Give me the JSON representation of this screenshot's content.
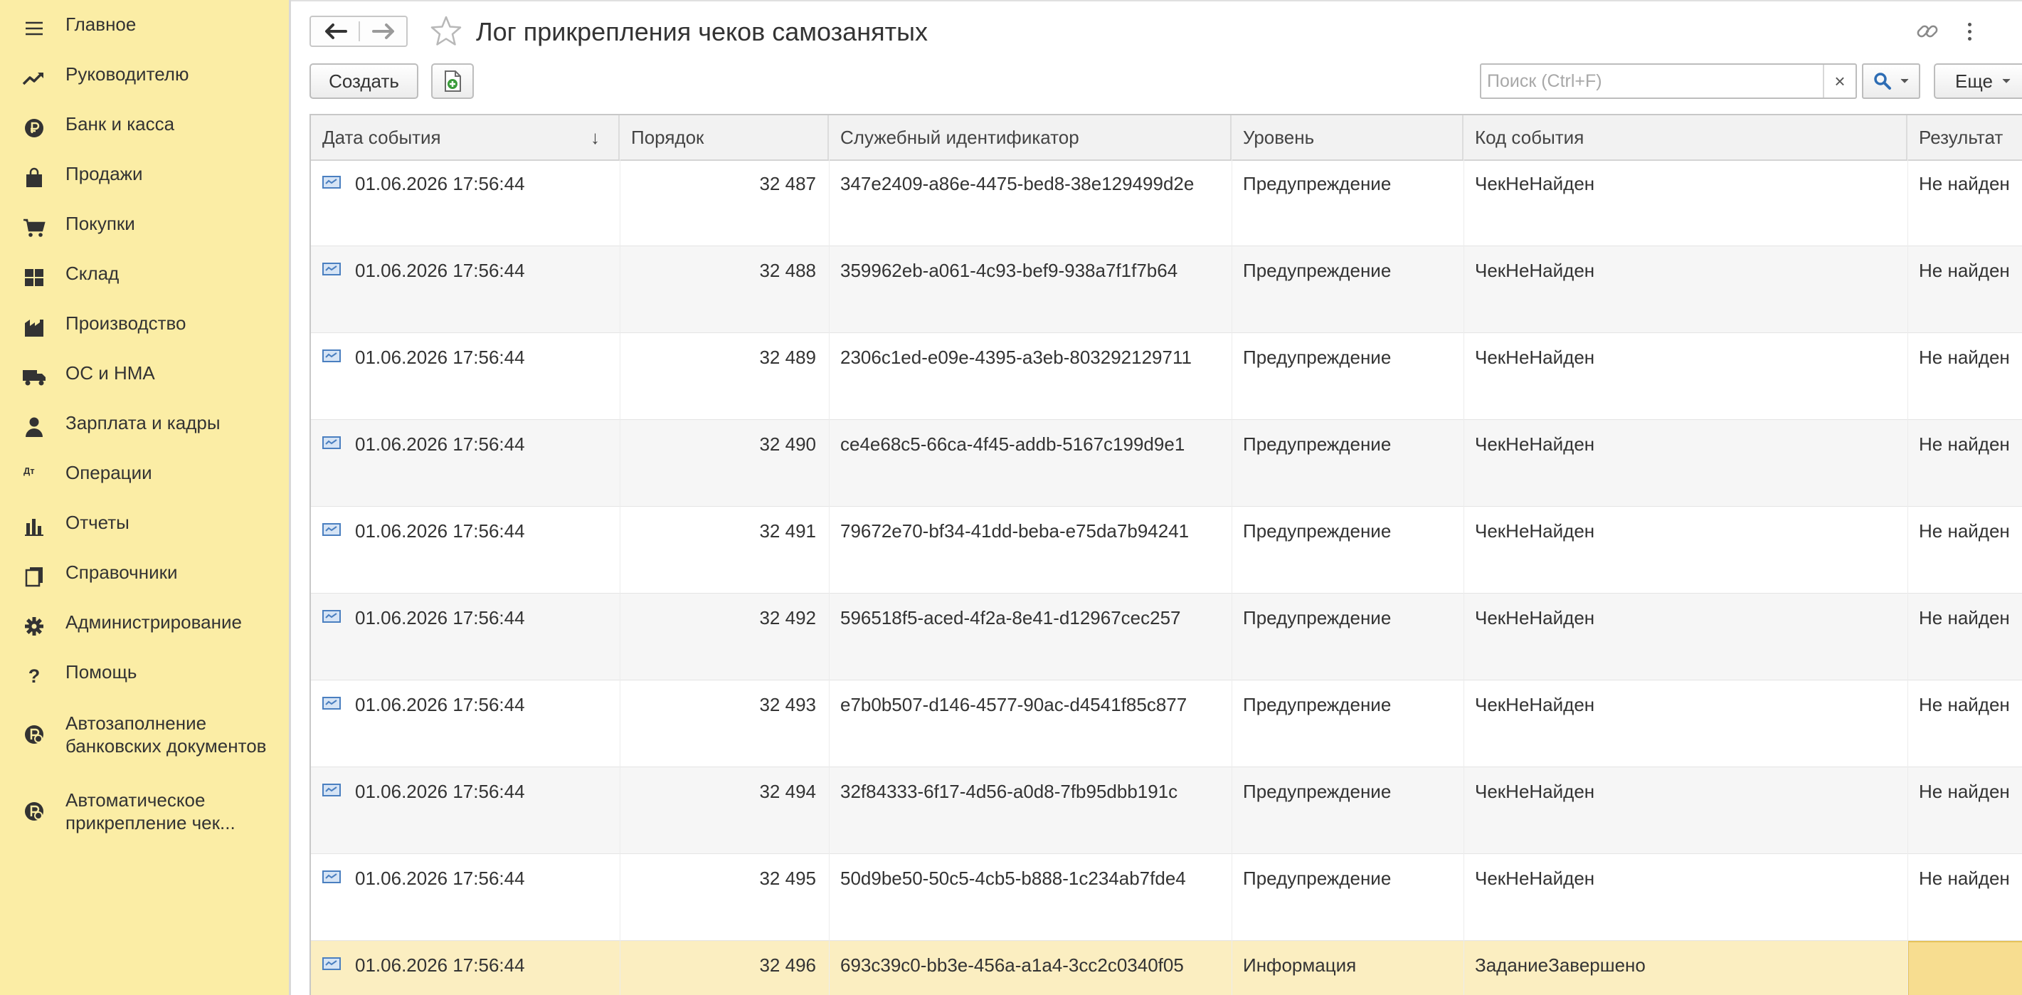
{
  "sidebar": {
    "items": [
      {
        "label": "Главное",
        "icon": "menu-icon"
      },
      {
        "label": "Руководителю",
        "icon": "trend-chart-icon"
      },
      {
        "label": "Банк и касса",
        "icon": "ruble-coin-icon"
      },
      {
        "label": "Продажи",
        "icon": "shopping-bag-icon"
      },
      {
        "label": "Покупки",
        "icon": "shopping-cart-icon"
      },
      {
        "label": "Склад",
        "icon": "warehouse-icon"
      },
      {
        "label": "Производство",
        "icon": "factory-icon"
      },
      {
        "label": "ОС и НМА",
        "icon": "truck-icon"
      },
      {
        "label": "Зарплата и кадры",
        "icon": "person-icon"
      },
      {
        "label": "Операции",
        "icon": "debit-credit-icon"
      },
      {
        "label": "Отчеты",
        "icon": "bar-chart-icon"
      },
      {
        "label": "Справочники",
        "icon": "books-icon"
      },
      {
        "label": "Администрирование",
        "icon": "gear-icon"
      },
      {
        "label": "Помощь",
        "icon": "question-icon"
      },
      {
        "label": "Автозаполнение\nбанковских документов",
        "icon": "extension-icon"
      },
      {
        "label": "Автоматическое\nприкрепление чек...",
        "icon": "extension-icon"
      }
    ],
    "debit_credit_glyph": "Дт Кт"
  },
  "header": {
    "title": "Лог прикрепления чеков самозанятых",
    "back_icon": "arrow-left-icon",
    "forward_icon": "arrow-right-icon",
    "favorite_icon": "star-icon",
    "link_icon": "link-icon",
    "more_icon": "vertical-dots-icon"
  },
  "toolbar": {
    "create_label": "Создать",
    "excel_icon": "excel-export-icon",
    "search_placeholder": "Поиск (Ctrl+F)",
    "search_value": "",
    "clear_glyph": "×",
    "search_icon": "magnifier-icon",
    "more_label": "Еще"
  },
  "table": {
    "sort_arrow": "↓",
    "columns": [
      "Дата события",
      "Порядок",
      "Служебный идентификатор",
      "Уровень",
      "Код события",
      "Результат"
    ],
    "rows": [
      {
        "date": "01.06.2026 17:56:44",
        "order": "32 487",
        "id": "347e2409-a86e-4475-bed8-38e129499d2e",
        "level": "Предупреждение",
        "code": "ЧекНеНайден",
        "result": "Не найден"
      },
      {
        "date": "01.06.2026 17:56:44",
        "order": "32 488",
        "id": "359962eb-a061-4c93-bef9-938a7f1f7b64",
        "level": "Предупреждение",
        "code": "ЧекНеНайден",
        "result": "Не найден"
      },
      {
        "date": "01.06.2026 17:56:44",
        "order": "32 489",
        "id": "2306c1ed-e09e-4395-a3eb-803292129711",
        "level": "Предупреждение",
        "code": "ЧекНеНайден",
        "result": "Не найден"
      },
      {
        "date": "01.06.2026 17:56:44",
        "order": "32 490",
        "id": "ce4e68c5-66ca-4f45-addb-5167c199d9e1",
        "level": "Предупреждение",
        "code": "ЧекНеНайден",
        "result": "Не найден"
      },
      {
        "date": "01.06.2026 17:56:44",
        "order": "32 491",
        "id": "79672e70-bf34-41dd-beba-e75da7b94241",
        "level": "Предупреждение",
        "code": "ЧекНеНайден",
        "result": "Не найден"
      },
      {
        "date": "01.06.2026 17:56:44",
        "order": "32 492",
        "id": "596518f5-aced-4f2a-8e41-d12967cec257",
        "level": "Предупреждение",
        "code": "ЧекНеНайден",
        "result": "Не найден"
      },
      {
        "date": "01.06.2026 17:56:44",
        "order": "32 493",
        "id": "e7b0b507-d146-4577-90ac-d4541f85c877",
        "level": "Предупреждение",
        "code": "ЧекНеНайден",
        "result": "Не найден"
      },
      {
        "date": "01.06.2026 17:56:44",
        "order": "32 494",
        "id": "32f84333-6f17-4d56-a0d8-7fb95dbb191c",
        "level": "Предупреждение",
        "code": "ЧекНеНайден",
        "result": "Не найден"
      },
      {
        "date": "01.06.2026 17:56:44",
        "order": "32 495",
        "id": "50d9be50-50c5-4cb5-b888-1c234ab7fde4",
        "level": "Предупреждение",
        "code": "ЧекНеНайден",
        "result": "Не найден"
      },
      {
        "date": "01.06.2026 17:56:44",
        "order": "32 496",
        "id": "693c39c0-bb3e-456a-a1a4-3cc2c0340f05",
        "level": "Информация",
        "code": "ЗаданиеЗавершено",
        "result": ""
      }
    ],
    "selected_row": 9,
    "row_icon": "log-record-icon"
  },
  "colors": {
    "sidebar_bg": "#fbeda5",
    "selected_row": "#fbeec1",
    "header_bg": "#f2f2f2",
    "record_icon": "#4a7fc0"
  }
}
